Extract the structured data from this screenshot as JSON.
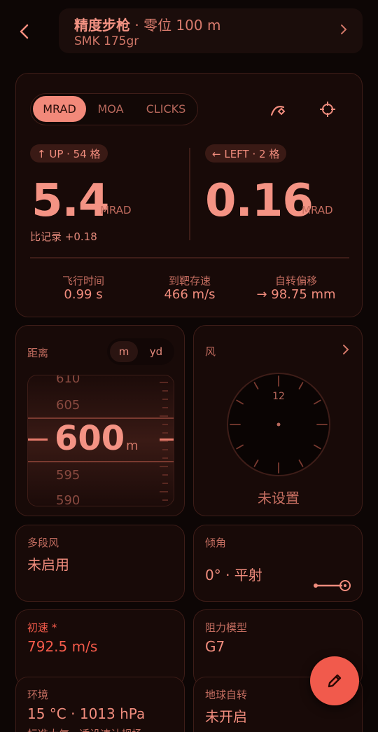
{
  "header": {
    "title": "精度步枪",
    "subtitle_sep": " · 零位 100 m",
    "ammo": "SMK 175gr"
  },
  "units": {
    "options": [
      "MRAD",
      "MOA",
      "CLICKS"
    ],
    "selected": "MRAD"
  },
  "elevation": {
    "pill": "↑ UP · 54 格",
    "value": "5.4",
    "unit": "MRAD",
    "compare": "比记录 +0.18"
  },
  "windage": {
    "pill": "← LEFT · 2 格",
    "value": "0.16",
    "unit": "MRAD"
  },
  "stats": [
    {
      "label": "飞行时间",
      "value": "0.99 s"
    },
    {
      "label": "到靶存速",
      "value": "466 m/s"
    },
    {
      "label": "自转偏移",
      "value": "→ 98.75 mm"
    }
  ],
  "distance": {
    "label": "距离",
    "units": [
      "m",
      "yd"
    ],
    "selected_unit": "m",
    "value": "600",
    "unit": "m",
    "drum_labels": [
      "610",
      "605",
      "595",
      "590"
    ]
  },
  "wind": {
    "label": "风",
    "clock_label": "12",
    "status": "未设置"
  },
  "multi_wind": {
    "label": "多段风",
    "value": "未启用"
  },
  "incline": {
    "label": "倾角",
    "value": "0° · 平射",
    "slider_fraction": 1.0
  },
  "muzzle": {
    "label": "初速 *",
    "value": "792.5 m/s"
  },
  "drag": {
    "label": "阻力模型",
    "value": "G7"
  },
  "env": {
    "label": "环境",
    "value": "15 °C · 1013 hPa",
    "note": "标准大气 · 适设速计规场"
  },
  "earth": {
    "label": "地球自转",
    "value": "未开启"
  },
  "colors": {
    "accent": "#f2897a",
    "fab": "#f15a4c",
    "warning": "#f45a4a"
  }
}
